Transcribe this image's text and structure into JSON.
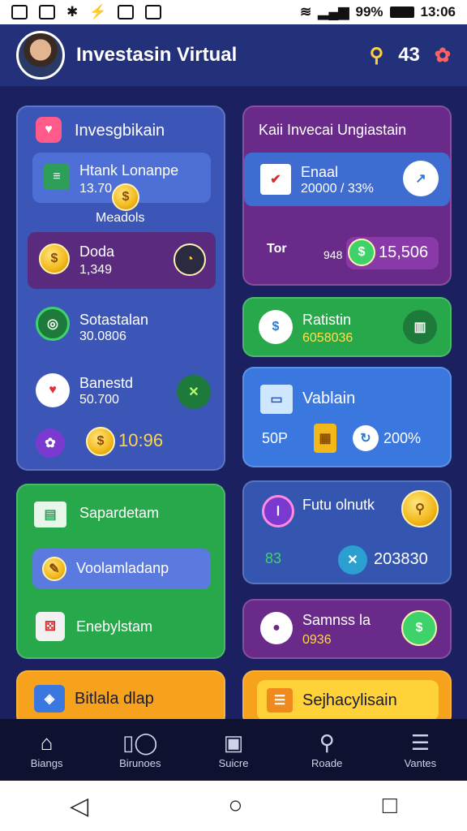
{
  "status_bar": {
    "battery": "99%",
    "time": "13:06"
  },
  "app_bar": {
    "title": "Investasin Virtual",
    "count": "43",
    "colors": {
      "bg": "#23307a"
    }
  },
  "cards": {
    "left_top": {
      "title": "Invesgbikain",
      "item1": {
        "title": "Htank Lonanpe",
        "value": "13.70",
        "caption": "Meadols"
      },
      "item2": {
        "title": "Doda",
        "value": "1,349"
      },
      "item3": {
        "title": "Sotastalan",
        "value": "30.0806"
      },
      "item4": {
        "title": "Banestd",
        "value": "50.700"
      },
      "total": "10:96"
    },
    "right_top": {
      "title": "Kaii Invecai Ungiastain",
      "item1": {
        "title": "Enaal",
        "value": "20000 / 33%"
      },
      "row": {
        "label": "Tor",
        "small": "948",
        "amount": "15,506"
      }
    },
    "right_green": {
      "title": "Ratistin",
      "value": "6058036"
    },
    "right_blue": {
      "title": "Vablain",
      "label1": "50P",
      "value": "200%"
    },
    "left_green": {
      "item1": "Sapardetam",
      "item2": "Voolamladanp",
      "item3": "Enebylstam"
    },
    "right_futu": {
      "title": "Futu olnutk",
      "value": "203830",
      "note": "83"
    },
    "right_purple": {
      "title": "Samnss la",
      "value": "0936"
    },
    "bottom_left": {
      "title": "Bitlala dlap"
    },
    "bottom_right": {
      "title": "Sejhacylisain"
    }
  },
  "nav": [
    {
      "label": "Biangs",
      "icon": "home-icon"
    },
    {
      "label": "Birunoes",
      "icon": "tools-icon"
    },
    {
      "label": "Suicre",
      "icon": "briefcase-icon"
    },
    {
      "label": "Roade",
      "icon": "search-icon"
    },
    {
      "label": "Vantes",
      "icon": "menu-icon"
    }
  ]
}
